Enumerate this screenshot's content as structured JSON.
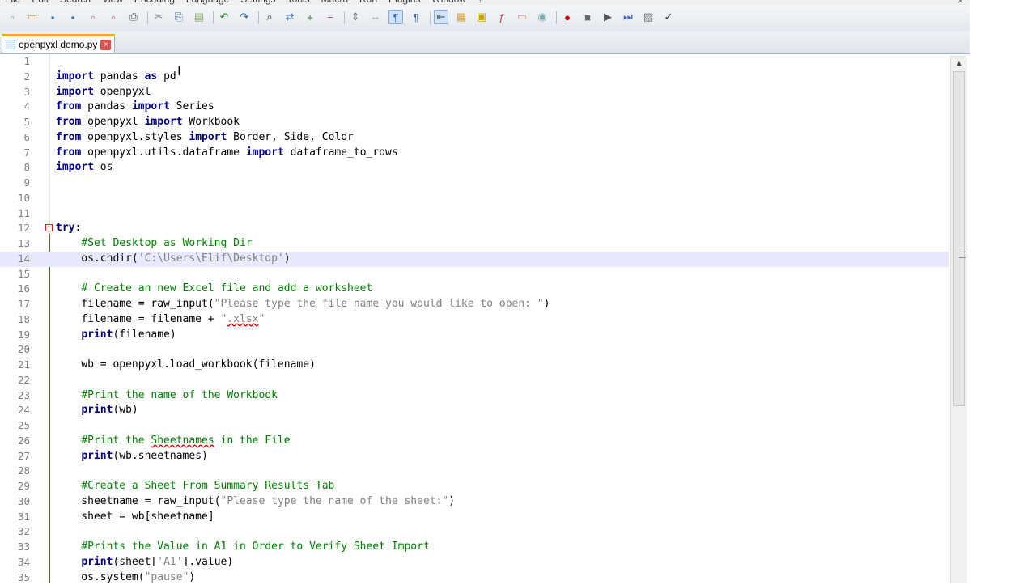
{
  "menu": [
    "File",
    "Edit",
    "Search",
    "View",
    "Encoding",
    "Language",
    "Settings",
    "Tools",
    "Macro",
    "Run",
    "Plugins",
    "Window",
    "?"
  ],
  "window_close": "×",
  "tab": {
    "filename": "openpyxl demo.py",
    "close_label": "×"
  },
  "toolbar_icons": [
    "new-file-icon",
    "open-folder-icon",
    "save-icon",
    "save-all-icon",
    "close-icon",
    "close-all-icon",
    "print-icon",
    "cut-icon",
    "copy-icon",
    "paste-icon",
    "undo-icon",
    "redo-icon",
    "find-icon",
    "replace-icon",
    "zoom-in-icon",
    "zoom-out-icon",
    "sync-vertical-icon",
    "sync-horizontal-icon",
    "word-wrap-icon",
    "show-all-chars-icon",
    "indent-guide-icon",
    "language-icon",
    "doc-map-icon",
    "function-list-icon",
    "folder-workspace-icon",
    "monitor-icon",
    "record-macro-icon",
    "stop-record-icon",
    "play-macro-icon",
    "run-macro-multiple-icon",
    "save-macro-icon",
    "spellcheck-icon"
  ],
  "current_line": 14,
  "lines": [
    {
      "n": "1",
      "t": ""
    },
    {
      "n": "2",
      "t": "import pandas as pd"
    },
    {
      "n": "3",
      "t": "import openpyxl"
    },
    {
      "n": "4",
      "t": "from pandas import Series"
    },
    {
      "n": "5",
      "t": "from openpyxl import Workbook"
    },
    {
      "n": "6",
      "t": "from openpyxl.styles import Border, Side, Color"
    },
    {
      "n": "7",
      "t": "from openpyxl.utils.dataframe import dataframe_to_rows"
    },
    {
      "n": "8",
      "t": "import os"
    },
    {
      "n": "9",
      "t": ""
    },
    {
      "n": "10",
      "t": ""
    },
    {
      "n": "11",
      "t": ""
    },
    {
      "n": "12",
      "t": "try:"
    },
    {
      "n": "13",
      "t": "    #Set Desktop as Working Dir"
    },
    {
      "n": "14",
      "t": "    os.chdir('C:\\Users\\Elif\\Desktop')"
    },
    {
      "n": "15",
      "t": ""
    },
    {
      "n": "16",
      "t": "    # Create an new Excel file and add a worksheet"
    },
    {
      "n": "17",
      "t": "    filename = raw_input(\"Please type the file name you would like to open: \")"
    },
    {
      "n": "18",
      "t": "    filename = filename + \".xlsx\""
    },
    {
      "n": "19",
      "t": "    print(filename)"
    },
    {
      "n": "20",
      "t": ""
    },
    {
      "n": "21",
      "t": "    wb = openpyxl.load_workbook(filename)"
    },
    {
      "n": "22",
      "t": ""
    },
    {
      "n": "23",
      "t": "    #Print the name of the Workbook"
    },
    {
      "n": "24",
      "t": "    print(wb)"
    },
    {
      "n": "25",
      "t": ""
    },
    {
      "n": "26",
      "t": "    #Print the Sheetnames in the File"
    },
    {
      "n": "27",
      "t": "    print(wb.sheetnames)"
    },
    {
      "n": "28",
      "t": ""
    },
    {
      "n": "29",
      "t": "    #Create a Sheet From Summary Results Tab"
    },
    {
      "n": "30",
      "t": "    sheetname = raw_input(\"Please type the name of the sheet:\")"
    },
    {
      "n": "31",
      "t": "    sheet = wb[sheetname]"
    },
    {
      "n": "32",
      "t": ""
    },
    {
      "n": "33",
      "t": "    #Prints the Value in A1 in Order to Verify Sheet Import"
    },
    {
      "n": "34",
      "t": "    print(sheet['A1'].value)"
    },
    {
      "n": "35",
      "t": "    os.system(\"pause\")"
    }
  ],
  "colors": {
    "keyword": "#000080",
    "comment": "#008000",
    "string": "#808080",
    "current_line": "#e8e8ff",
    "fold_marker": "#e02020",
    "tab_accent": "#f5a623"
  }
}
